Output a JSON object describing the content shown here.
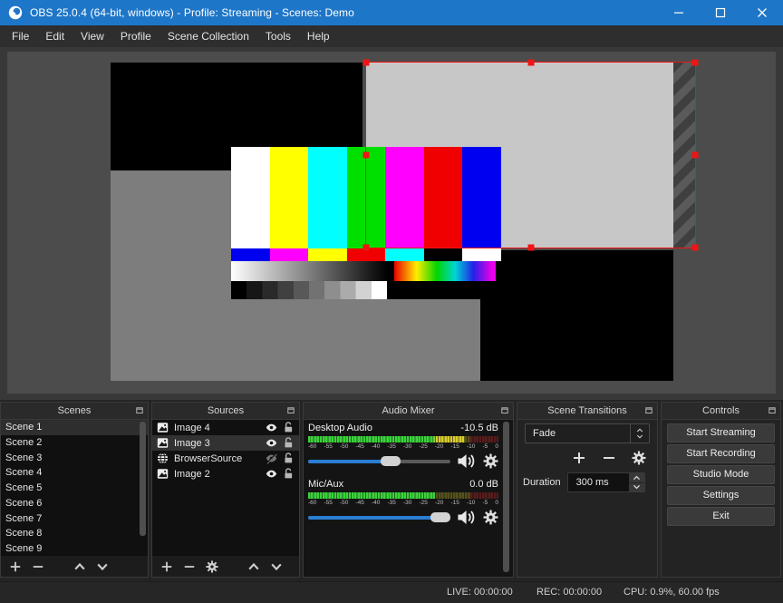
{
  "window": {
    "title": "OBS 25.0.4 (64-bit, windows) - Profile: Streaming - Scenes: Demo"
  },
  "menu": {
    "items": [
      "File",
      "Edit",
      "View",
      "Profile",
      "Scene Collection",
      "Tools",
      "Help"
    ]
  },
  "panels": {
    "scenes": {
      "title": "Scenes",
      "items": [
        "Scene 1",
        "Scene 2",
        "Scene 3",
        "Scene 4",
        "Scene 5",
        "Scene 6",
        "Scene 7",
        "Scene 8",
        "Scene 9"
      ],
      "selected": "Scene 1"
    },
    "sources": {
      "title": "Sources",
      "items": [
        {
          "name": "Image 4",
          "type": "image",
          "visible": true,
          "locked": false
        },
        {
          "name": "Image 3",
          "type": "image",
          "visible": true,
          "locked": false,
          "selected": true
        },
        {
          "name": "BrowserSource",
          "type": "browser",
          "visible": false,
          "locked": false
        },
        {
          "name": "Image 2",
          "type": "image",
          "visible": true,
          "locked": false
        }
      ]
    },
    "mixer": {
      "title": "Audio Mixer",
      "ticks": [
        "-60",
        "-55",
        "-50",
        "-45",
        "-40",
        "-35",
        "-30",
        "-25",
        "-20",
        "-15",
        "-10",
        "-5",
        "0"
      ],
      "channels": [
        {
          "name": "Desktop Audio",
          "gain": "-10.5 dB"
        },
        {
          "name": "Mic/Aux",
          "gain": "0.0 dB"
        }
      ]
    },
    "transitions": {
      "title": "Scene Transitions",
      "selected": "Fade",
      "duration_label": "Duration",
      "duration_value": "300 ms"
    },
    "controls": {
      "title": "Controls",
      "buttons": [
        "Start Streaming",
        "Start Recording",
        "Studio Mode",
        "Settings",
        "Exit"
      ]
    }
  },
  "statusbar": {
    "live": "LIVE: 00:00:00",
    "rec": "REC: 00:00:00",
    "cpu": "CPU: 0.9%, 60.00 fps"
  },
  "icons": {
    "scenes_toolbar": [
      "add",
      "remove",
      "move-up",
      "move-down"
    ],
    "sources_toolbar": [
      "add",
      "remove",
      "properties-gear",
      "move-up",
      "move-down"
    ],
    "source_row": [
      "visibility-eye",
      "unlock"
    ],
    "mixer_row": [
      "speaker",
      "settings-gear"
    ],
    "transitions_toolbar": [
      "add",
      "remove",
      "settings-gear"
    ]
  },
  "colors": {
    "titlebar_blue": "#1e76c8",
    "selection_red": "#f01414",
    "slider_blue": "#2a7fd4",
    "meter_green": "#3bd33b",
    "meter_yellow": "#d9cb30"
  }
}
